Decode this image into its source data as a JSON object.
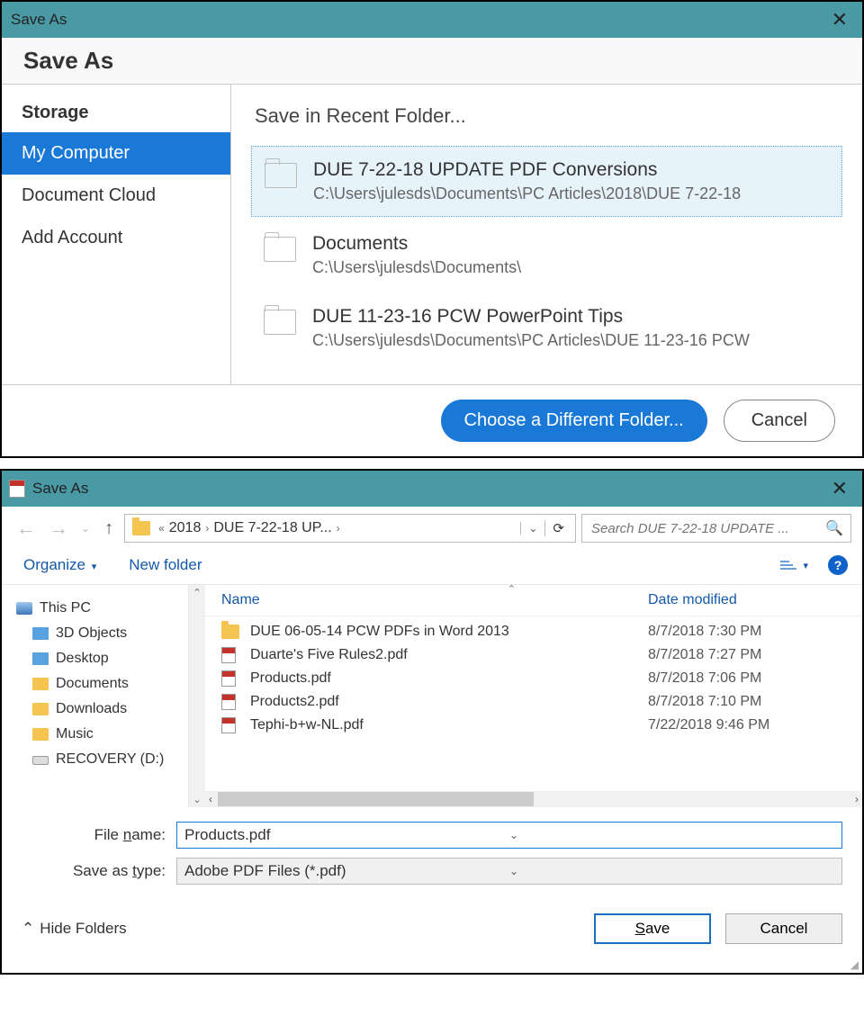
{
  "window1": {
    "titlebar": "Save As",
    "close": "✕",
    "header": "Save As",
    "sidebar": {
      "storage_label": "Storage",
      "items": [
        "My Computer",
        "Document Cloud",
        "Add Account"
      ],
      "active_index": 0
    },
    "main": {
      "heading": "Save in Recent Folder...",
      "recent": [
        {
          "title": "DUE 7-22-18 UPDATE PDF Conversions",
          "path": "C:\\Users\\julesds\\Documents\\PC Articles\\2018\\DUE 7-22-18 "
        },
        {
          "title": "Documents",
          "path": "C:\\Users\\julesds\\Documents\\"
        },
        {
          "title": "DUE 11-23-16 PCW PowerPoint Tips",
          "path": "C:\\Users\\julesds\\Documents\\PC Articles\\DUE 11-23-16 PCW"
        }
      ],
      "selected_index": 0
    },
    "footer": {
      "choose": "Choose a Different Folder...",
      "cancel": "Cancel"
    }
  },
  "window2": {
    "titlebar": "Save As",
    "close": "✕",
    "breadcrumb": {
      "chevrons": "«",
      "seg1": "2018",
      "seg2": "DUE 7-22-18 UP...",
      "refresh": "⟳"
    },
    "search_placeholder": "Search DUE 7-22-18 UPDATE ...",
    "toolbar": {
      "organize": "Organize",
      "new_folder": "New folder"
    },
    "tree": [
      {
        "label": "This PC",
        "kind": "pc",
        "indent": 0
      },
      {
        "label": "3D Objects",
        "kind": "fld blue",
        "indent": 1
      },
      {
        "label": "Desktop",
        "kind": "fld blue",
        "indent": 1
      },
      {
        "label": "Documents",
        "kind": "fld",
        "indent": 1
      },
      {
        "label": "Downloads",
        "kind": "fld",
        "indent": 1
      },
      {
        "label": "Music",
        "kind": "fld",
        "indent": 1
      },
      {
        "label": "RECOVERY (D:)",
        "kind": "disk",
        "indent": 1
      }
    ],
    "columns": {
      "name": "Name",
      "date": "Date modified"
    },
    "files": [
      {
        "name": "DUE 06-05-14 PCW PDFs in Word 2013",
        "date": "8/7/2018 7:30 PM",
        "kind": "folder"
      },
      {
        "name": "Duarte's Five Rules2.pdf",
        "date": "8/7/2018 7:27 PM",
        "kind": "pdf"
      },
      {
        "name": "Products.pdf",
        "date": "8/7/2018 7:06 PM",
        "kind": "pdf"
      },
      {
        "name": "Products2.pdf",
        "date": "8/7/2018 7:10 PM",
        "kind": "pdf"
      },
      {
        "name": "Tephi-b+w-NL.pdf",
        "date": "7/22/2018 9:46 PM",
        "kind": "pdf"
      }
    ],
    "filename_label": "File name:",
    "filename_value": "Products.pdf",
    "savetype_label": "Save as type:",
    "savetype_value": "Adobe PDF Files (*.pdf)",
    "hide_folders": "Hide Folders",
    "save_label": "Save",
    "cancel_label": "Cancel"
  }
}
